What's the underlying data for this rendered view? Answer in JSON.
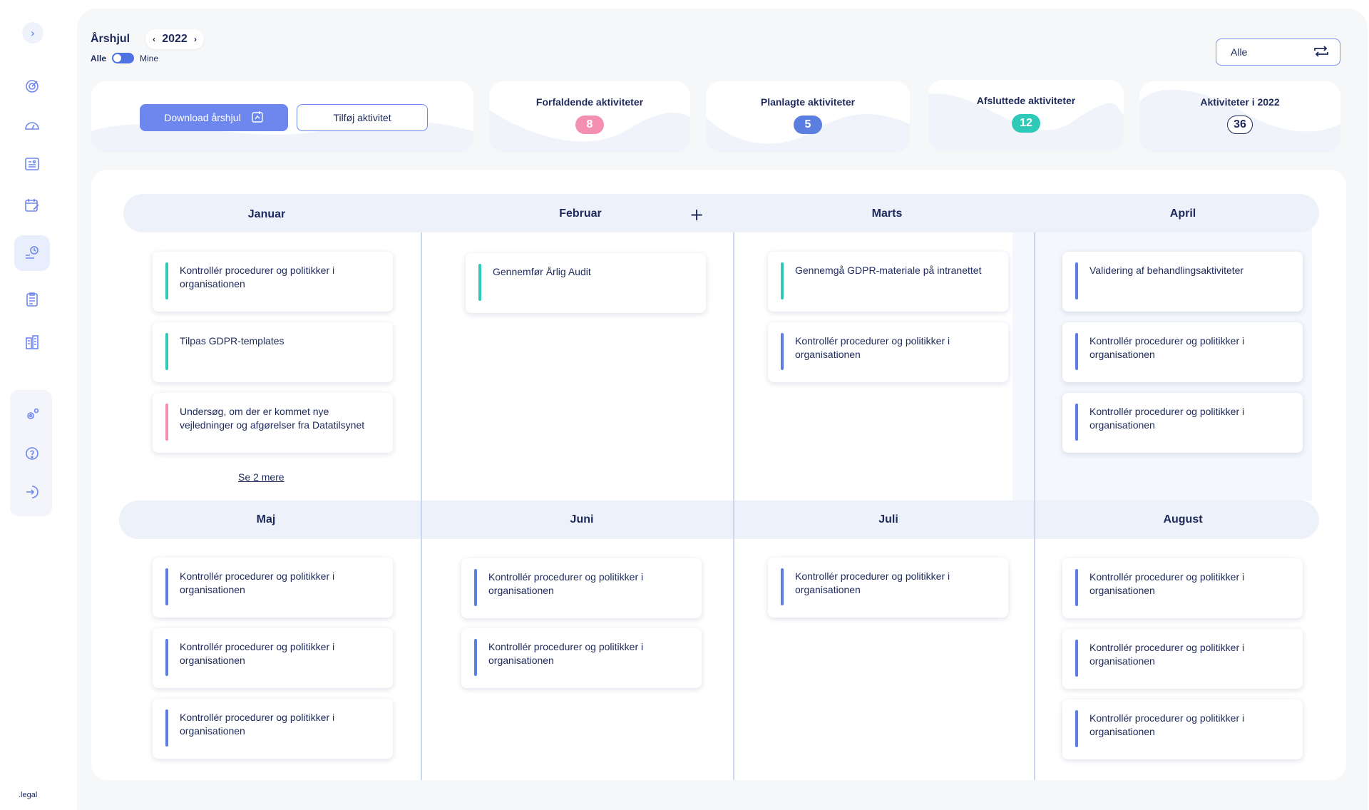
{
  "header": {
    "title": "Årshjul",
    "year": "2022",
    "toggle_left": "Alle",
    "toggle_right": "Mine",
    "filter_value": "Alle"
  },
  "actions": {
    "download_label": "Download årshjul",
    "add_label": "Tilføj aktivitet"
  },
  "stats": [
    {
      "label": "Forfaldende aktiviteter",
      "value": "8",
      "color": "#f48fb1"
    },
    {
      "label": "Planlagte aktiviteter",
      "value": "5",
      "color": "#5b7fe0"
    },
    {
      "label": "Afsluttede aktiviteter",
      "value": "12",
      "color": "#2ec9b7"
    },
    {
      "label": "Aktiviteter i 2022",
      "value": "36",
      "color": "#ffffff"
    }
  ],
  "months_row1": [
    "Januar",
    "Februar",
    "Marts",
    "April"
  ],
  "months_row2": [
    "Maj",
    "Juni",
    "Juli",
    "August"
  ],
  "tasks": {
    "jan": [
      {
        "text": "Kontrollér procedurer og politikker i organisationen",
        "color": "#2ec9b7"
      },
      {
        "text": "Tilpas GDPR-templates",
        "color": "#2ec9b7"
      },
      {
        "text": "Undersøg, om der er kommet nye vejledninger og afgørelser fra Datatilsynet",
        "color": "#f48fb1"
      }
    ],
    "feb": [
      {
        "text": "Gennemfør Årlig Audit",
        "color": "#2ec9b7"
      }
    ],
    "mar": [
      {
        "text": "Gennemgå GDPR-materiale på intranettet",
        "color": "#2ec9b7"
      },
      {
        "text": "Kontrollér procedurer og politikker i organisationen",
        "color": "#5b7fe0"
      }
    ],
    "apr": [
      {
        "text": "Validering af behandlingsaktiviteter",
        "color": "#5b7fe0"
      },
      {
        "text": "Kontrollér procedurer og politikker i organisationen",
        "color": "#5b7fe0"
      },
      {
        "text": "Kontrollér procedurer og politikker i organisationen",
        "color": "#5b7fe0"
      }
    ],
    "maj": [
      {
        "text": "Kontrollér procedurer og politikker i organisationen",
        "color": "#5b7fe0"
      },
      {
        "text": "Kontrollér procedurer og politikker i organisationen",
        "color": "#5b7fe0"
      },
      {
        "text": "Kontrollér procedurer og politikker i organisationen",
        "color": "#5b7fe0"
      }
    ],
    "jun": [
      {
        "text": "Kontrollér procedurer og politikker i organisationen",
        "color": "#5b7fe0"
      },
      {
        "text": "Kontrollér procedurer og politikker i organisationen",
        "color": "#5b7fe0"
      }
    ],
    "jul": [
      {
        "text": "Kontrollér procedurer og politikker i organisationen",
        "color": "#5b7fe0"
      }
    ],
    "aug": [
      {
        "text": "Kontrollér procedurer og politikker i organisationen",
        "color": "#5b7fe0"
      },
      {
        "text": "Kontrollér procedurer og politikker i organisationen",
        "color": "#5b7fe0"
      },
      {
        "text": "Kontrollér procedurer og politikker i organisationen",
        "color": "#5b7fe0"
      }
    ]
  },
  "see_more": "Se 2 mere",
  "brand": ".legal",
  "sidebar_icons": [
    "target-icon",
    "gauge-icon",
    "dashboard-icon",
    "calendar-edit-icon",
    "annual-wheel-icon",
    "clipboard-icon",
    "buildings-icon",
    "settings-icon",
    "help-icon",
    "logout-icon"
  ]
}
